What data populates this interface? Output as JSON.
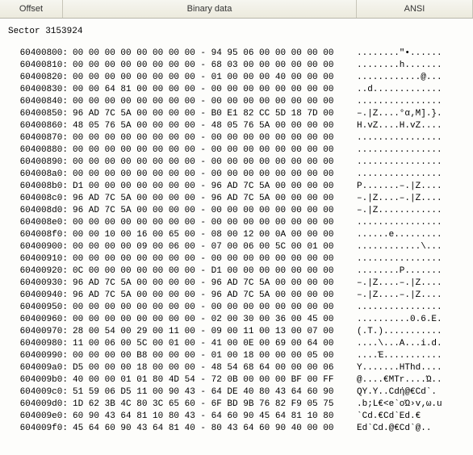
{
  "header": {
    "offset": "Offset",
    "binary": "Binary data",
    "ansi": "ANSI"
  },
  "sector_label": "Sector 3153924",
  "rows": [
    {
      "o": "60400800:",
      "h": "00 00 00 00 00 00 00 00 - 94 95 06 00 00 00 00 00",
      "a": "........\"•......"
    },
    {
      "o": "60400810:",
      "h": "00 00 00 00 00 00 00 00 - 68 03 00 00 00 00 00 00",
      "a": "........h......."
    },
    {
      "o": "60400820:",
      "h": "00 00 00 00 00 00 00 00 - 01 00 00 00 40 00 00 00",
      "a": "............@..."
    },
    {
      "o": "60400830:",
      "h": "00 00 64 81 00 00 00 00 - 00 00 00 00 00 00 00 00",
      "a": "..d............."
    },
    {
      "o": "60400840:",
      "h": "00 00 00 00 00 00 00 00 - 00 00 00 00 00 00 00 00",
      "a": "................"
    },
    {
      "o": "60400850:",
      "h": "96 AD 7C 5A 00 00 00 00 - B0 E1 82 CC 5D 18 7D 00",
      "a": "–.|Z....°α‚Μ].}."
    },
    {
      "o": "60400860:",
      "h": "48 05 76 5A 00 00 00 00 - 48 05 76 5A 00 00 00 00",
      "a": "H.vZ....H.vZ...."
    },
    {
      "o": "60400870:",
      "h": "00 00 00 00 00 00 00 00 - 00 00 00 00 00 00 00 00",
      "a": "................"
    },
    {
      "o": "60400880:",
      "h": "00 00 00 00 00 00 00 00 - 00 00 00 00 00 00 00 00",
      "a": "................"
    },
    {
      "o": "60400890:",
      "h": "00 00 00 00 00 00 00 00 - 00 00 00 00 00 00 00 00",
      "a": "................"
    },
    {
      "o": "604008a0:",
      "h": "00 00 00 00 00 00 00 00 - 00 00 00 00 00 00 00 00",
      "a": "................"
    },
    {
      "o": "604008b0:",
      "h": "D1 00 00 00 00 00 00 00 - 96 AD 7C 5A 00 00 00 00",
      "a": "Ρ.......–.|Z...."
    },
    {
      "o": "604008c0:",
      "h": "96 AD 7C 5A 00 00 00 00 - 96 AD 7C 5A 00 00 00 00",
      "a": "–.|Z....–.|Z...."
    },
    {
      "o": "604008d0:",
      "h": "96 AD 7C 5A 00 00 00 00 - 00 00 00 00 00 00 00 00",
      "a": "–.|Z............"
    },
    {
      "o": "604008e0:",
      "h": "00 00 00 00 00 00 00 00 - 00 00 00 00 00 00 00 00",
      "a": "................"
    },
    {
      "o": "604008f0:",
      "h": "00 00 10 00 16 00 65 00 - 08 00 12 00 0A 00 00 00",
      "a": "......e........."
    },
    {
      "o": "60400900:",
      "h": "00 00 00 00 09 00 06 00 - 07 00 06 00 5C 00 01 00",
      "a": "............\\..."
    },
    {
      "o": "60400910:",
      "h": "00 00 00 00 00 00 00 00 - 00 00 00 00 00 00 00 00",
      "a": "................"
    },
    {
      "o": "60400920:",
      "h": "0C 00 00 00 00 00 00 00 - D1 00 00 00 00 00 00 00",
      "a": "........Ρ......."
    },
    {
      "o": "60400930:",
      "h": "96 AD 7C 5A 00 00 00 00 - 96 AD 7C 5A 00 00 00 00",
      "a": "–.|Z....–.|Z...."
    },
    {
      "o": "60400940:",
      "h": "96 AD 7C 5A 00 00 00 00 - 96 AD 7C 5A 00 00 00 00",
      "a": "–.|Z....–.|Z...."
    },
    {
      "o": "60400950:",
      "h": "00 00 00 00 00 00 00 00 - 00 00 00 00 00 00 00 00",
      "a": "................"
    },
    {
      "o": "60400960:",
      "h": "00 00 00 00 00 00 00 00 - 02 00 30 00 36 00 45 00",
      "a": "..........0.6.E."
    },
    {
      "o": "60400970:",
      "h": "28 00 54 00 29 00 11 00 - 09 00 11 00 13 00 07 00",
      "a": "(.T.)..........."
    },
    {
      "o": "60400980:",
      "h": "11 00 06 00 5C 00 01 00 - 41 00 0E 00 69 00 64 00",
      "a": "....\\...A...i.d."
    },
    {
      "o": "60400990:",
      "h": "00 00 00 00 B8 00 00 00 - 01 00 18 00 00 00 05 00",
      "a": "....Έ..........."
    },
    {
      "o": "604009a0:",
      "h": "D5 00 00 00 18 00 00 00 - 48 54 68 64 00 00 00 06",
      "a": "Υ.......HThd...."
    },
    {
      "o": "604009b0:",
      "h": "40 00 00 01 01 80 4D 54 - 72 0B 00 00 00 BF 00 FF",
      "a": "@....€MTr....Ώ.."
    },
    {
      "o": "604009c0:",
      "h": "51 59 06 D5 11 00 90 43 - 64 DE 40 80 43 64 60 90",
      "a": "QY.Υ..Cdή@€Cd`."
    },
    {
      "o": "604009d0:",
      "h": "1D 62 3B 4C 80 3C 65 60 - 6F BD 9B 76 82 F9 05 75",
      "a": ".b;L€<e`oΏ›v‚ω.u"
    },
    {
      "o": "604009e0:",
      "h": "60 90 43 64 81 10 80 43 - 64 60 90 45 64 81 10 80",
      "a": "`Cd.€Cd`Ed.€"
    },
    {
      "o": "604009f0:",
      "h": "45 64 60 90 43 64 81 40 - 80 43 64 60 90 40 00 00",
      "a": "Ed`Cd.@€Cd`@.."
    }
  ]
}
